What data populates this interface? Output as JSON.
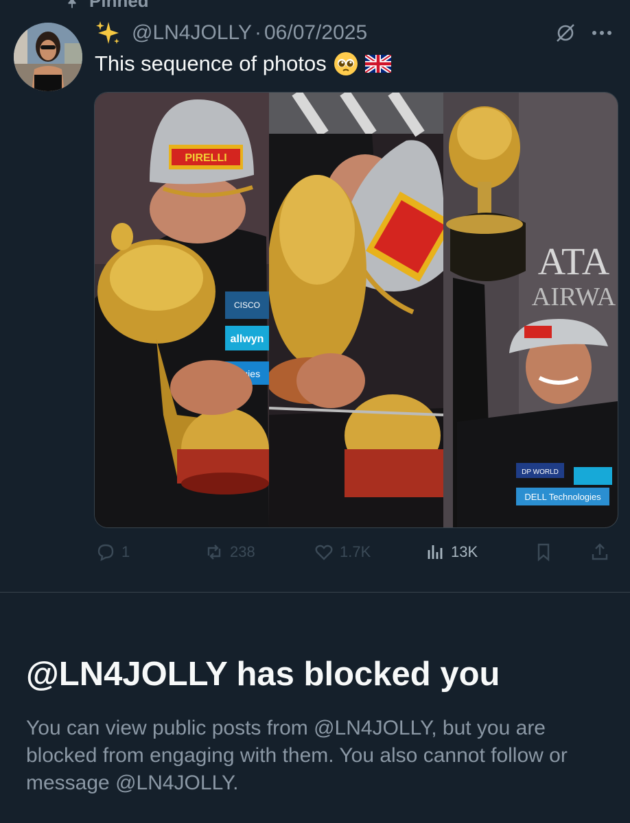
{
  "pinned_label": "Pinned",
  "tweet": {
    "handle": "@LN4JOLLY",
    "separator": "·",
    "date": "06/07/2025",
    "text": "This sequence of photos",
    "emoji_icon": "pleading-face-emoji",
    "flag_icon": "uk-flag-emoji"
  },
  "actions": {
    "replies": "1",
    "reposts": "238",
    "likes": "1.7K",
    "views": "13K"
  },
  "photo_labels": {
    "pirelli": "PIRELLI",
    "cisco": "CISCO",
    "allwyn": "allwyn",
    "technologies": "nologies",
    "ata": "ATA",
    "airwa": "AIRWA",
    "dp_world": "DP WORLD",
    "dell": "DELL Technologies"
  },
  "blocked": {
    "title": "@LN4JOLLY has blocked you",
    "description": "You can view public posts from @LN4JOLLY, but you are blocked from engaging with them. You also cannot follow or message @LN4JOLLY."
  },
  "colors": {
    "background": "#15202b",
    "primary_text": "#f7f9f9",
    "secondary_text": "#8b98a5",
    "border": "#38444d"
  }
}
